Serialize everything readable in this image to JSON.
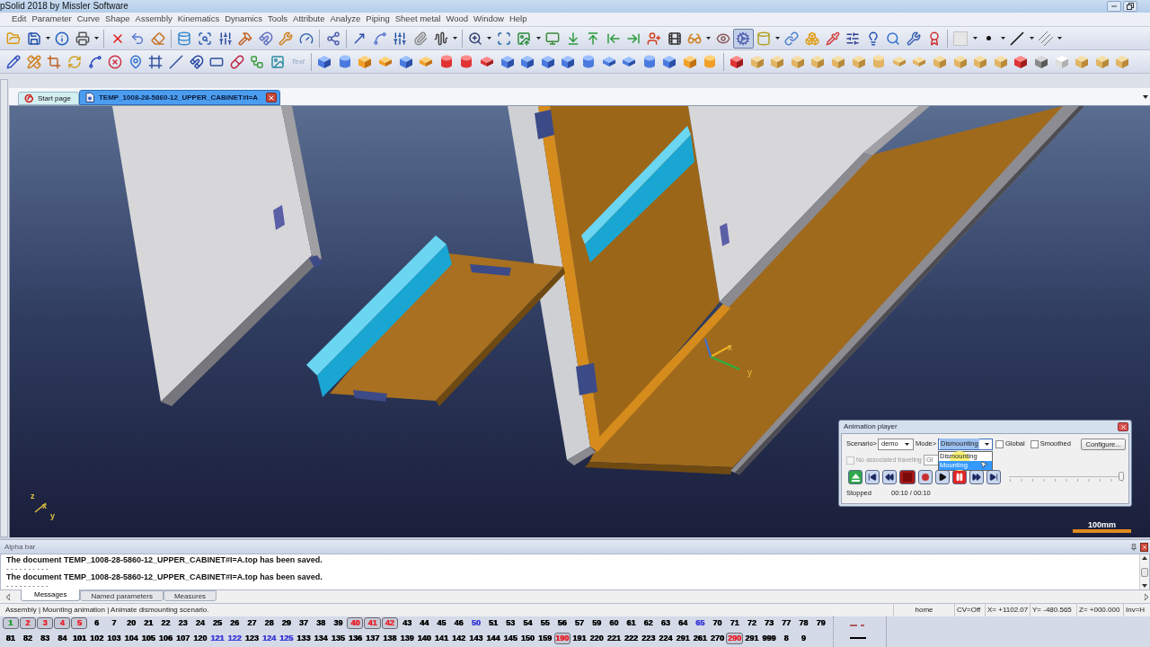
{
  "window": {
    "title": "pSolid 2018 by Missler Software"
  },
  "menu": [
    "Edit",
    "Parameter",
    "Curve",
    "Shape",
    "Assembly",
    "Kinematics",
    "Dynamics",
    "Tools",
    "Attribute",
    "Analyze",
    "Piping",
    "Sheet metal",
    "Wood",
    "Window",
    "Help"
  ],
  "toolbars": [
    {
      "buttons": [
        {
          "selected": false
        },
        {
          "selected": false
        },
        {
          "selected": false
        },
        {
          "selected": false
        },
        {
          "selected": false
        },
        {
          "selected": false
        },
        {
          "selected": false
        },
        {
          "selected": false
        },
        {
          "selected": false
        },
        {
          "selected": false
        },
        {
          "selected": false
        },
        {
          "selected": false
        },
        {
          "selected": false
        },
        {
          "selected": false
        },
        {
          "selected": false
        },
        {
          "selected": false
        },
        {
          "selected": false
        },
        {
          "selected": false
        },
        {
          "selected": false
        },
        {
          "selected": false
        },
        {
          "selected": false
        },
        {
          "selected": false
        },
        {
          "selected": false
        },
        {
          "selected": false
        },
        {
          "selected": false
        },
        {
          "selected": false
        },
        {
          "selected": false
        },
        {
          "selected": false
        },
        {
          "selected": false
        },
        {
          "selected": false
        },
        {
          "selected": false
        },
        {
          "selected": false
        },
        {
          "selected": true
        },
        {
          "selected": false
        },
        {
          "selected": false
        },
        {
          "selected": false
        },
        {
          "selected": false
        },
        {
          "selected": false
        },
        {
          "selected": false
        },
        {
          "selected": false
        },
        {
          "selected": false
        },
        {
          "selected": false
        },
        {
          "selected": false
        },
        {
          "selected": false
        },
        {
          "selected": false
        },
        {
          "selected": false
        }
      ]
    },
    {
      "buttons": [
        {
          "selected": false
        },
        {
          "selected": false
        },
        {
          "selected": false
        },
        {
          "selected": false
        },
        {
          "selected": false
        },
        {
          "selected": false
        },
        {
          "selected": false
        },
        {
          "selected": false
        },
        {
          "selected": false
        },
        {
          "selected": false
        },
        {
          "selected": false
        },
        {
          "selected": false
        },
        {
          "selected": false
        },
        {
          "selected": false
        },
        {
          "label": "Text",
          "selected": false
        },
        {
          "selected": false
        },
        {
          "selected": false
        },
        {
          "selected": false
        },
        {
          "selected": false
        },
        {
          "selected": false
        },
        {
          "selected": false
        },
        {
          "selected": false
        },
        {
          "selected": false
        },
        {
          "selected": false
        },
        {
          "selected": false
        },
        {
          "selected": false
        },
        {
          "selected": false
        },
        {
          "selected": false
        },
        {
          "selected": false
        },
        {
          "selected": false
        },
        {
          "selected": false
        },
        {
          "selected": false
        },
        {
          "selected": false
        },
        {
          "selected": false
        },
        {
          "selected": false
        },
        {
          "selected": false
        },
        {
          "selected": false
        },
        {
          "selected": false
        },
        {
          "selected": false
        },
        {
          "selected": false
        },
        {
          "selected": false
        },
        {
          "selected": false
        },
        {
          "selected": false
        },
        {
          "selected": false
        },
        {
          "selected": false
        },
        {
          "selected": false
        },
        {
          "selected": false
        },
        {
          "selected": false
        },
        {
          "selected": false
        },
        {
          "selected": false
        },
        {
          "selected": false
        },
        {
          "selected": false
        },
        {
          "selected": false
        },
        {
          "selected": false
        },
        {
          "selected": false
        }
      ]
    }
  ],
  "document_tabs": [
    {
      "kind": "start_page",
      "label": "Start page",
      "selected": false
    },
    {
      "kind": "document",
      "label": "TEMP_1008-28-5860-12_UPPER_CABINET#I=A",
      "selected": true
    }
  ],
  "viewport": {
    "triad_labels": [
      "x",
      "y"
    ],
    "corner_axis_labels": [
      "z",
      "x",
      "y"
    ],
    "scale_label": "100mm"
  },
  "animation_player": {
    "title": "Animation player",
    "scenario_label": "Scenario>",
    "scenario": "demo",
    "mode_label": "Mode>",
    "mode": "Dismounting",
    "mode_options": [
      {
        "label": "Dismounting",
        "selected": false
      },
      {
        "label": "Mounting",
        "selected": true
      }
    ],
    "global": {
      "label": "Global",
      "checked": false
    },
    "smoothed": {
      "label": "Smoothed",
      "checked": false
    },
    "configure": "Configure...",
    "traveling": {
      "label": "No associated traveling",
      "checked": false,
      "disabled": true
    },
    "traveling_field": "Gl",
    "progress": {
      "level": 1
    },
    "status": "Stopped",
    "time": "00:10 / 00:10"
  },
  "alpha_bar": {
    "title": "Alpha bar",
    "messages": [
      {
        "kind": "text",
        "text": "The document TEMP_1008-28-5860-12_UPPER_CABINET#I=A.top has been saved."
      },
      {
        "kind": "separator",
        "text": "- - - - - - - - - -"
      },
      {
        "kind": "text",
        "text": "The document TEMP_1008-28-5860-12_UPPER_CABINET#I=A.top has been saved."
      },
      {
        "kind": "separator",
        "text": "- - - - - - - - - -"
      }
    ],
    "tabs": [
      {
        "label": "Messages",
        "selected": true
      },
      {
        "label": "Named parameters",
        "selected": false
      },
      {
        "label": "Measures",
        "selected": false
      }
    ]
  },
  "status_bar": {
    "message": "Assembly | Mounting animation | Animate dismounting scenario.",
    "fields": [
      "home",
      "CV=Off",
      "X= +1102.07",
      "Y= -480.565",
      "Z= +000.000",
      "Inv=H"
    ]
  },
  "layers": {
    "rows": [
      [
        {
          "label": "1",
          "selected": true,
          "color": "#1e9e2e"
        },
        {
          "label": "2",
          "selected": true,
          "color": "#e8202a"
        },
        {
          "label": "3",
          "selected": true,
          "color": "#e8202a"
        },
        {
          "label": "4",
          "selected": true,
          "color": "#e8202a"
        },
        {
          "label": "5",
          "selected": true,
          "color": "#e8202a"
        },
        {
          "label": "6",
          "selected": false,
          "color": "#000000"
        },
        {
          "label": "7",
          "selected": false,
          "color": "#000000"
        },
        {
          "label": "20",
          "selected": false,
          "color": "#000000"
        },
        {
          "label": "21",
          "selected": false,
          "color": "#000000"
        },
        {
          "label": "22",
          "selected": false,
          "color": "#000000"
        },
        {
          "label": "23",
          "selected": false,
          "color": "#000000"
        },
        {
          "label": "24",
          "selected": false,
          "color": "#000000"
        },
        {
          "label": "25",
          "selected": false,
          "color": "#000000"
        },
        {
          "label": "26",
          "selected": false,
          "color": "#000000"
        },
        {
          "label": "27",
          "selected": false,
          "color": "#000000"
        },
        {
          "label": "28",
          "selected": false,
          "color": "#000000"
        },
        {
          "label": "29",
          "selected": false,
          "color": "#000000"
        },
        {
          "label": "37",
          "selected": false,
          "color": "#000000"
        },
        {
          "label": "38",
          "selected": false,
          "color": "#000000"
        },
        {
          "label": "39",
          "selected": false,
          "color": "#000000"
        },
        {
          "label": "40",
          "selected": true,
          "color": "#e8202a"
        },
        {
          "label": "41",
          "selected": true,
          "color": "#e8202a"
        },
        {
          "label": "42",
          "selected": true,
          "color": "#e8202a"
        },
        {
          "label": "43",
          "selected": false,
          "color": "#000000"
        },
        {
          "label": "44",
          "selected": false,
          "color": "#000000"
        },
        {
          "label": "45",
          "selected": false,
          "color": "#000000"
        },
        {
          "label": "46",
          "selected": false,
          "color": "#000000"
        },
        {
          "label": "50",
          "selected": false,
          "color": "#3c3cd8"
        },
        {
          "label": "51",
          "selected": false,
          "color": "#000000"
        },
        {
          "label": "53",
          "selected": false,
          "color": "#000000"
        },
        {
          "label": "54",
          "selected": false,
          "color": "#000000"
        },
        {
          "label": "55",
          "selected": false,
          "color": "#000000"
        },
        {
          "label": "56",
          "selected": false,
          "color": "#000000"
        },
        {
          "label": "57",
          "selected": false,
          "color": "#000000"
        },
        {
          "label": "59",
          "selected": false,
          "color": "#000000"
        },
        {
          "label": "60",
          "selected": false,
          "color": "#000000"
        },
        {
          "label": "61",
          "selected": false,
          "color": "#000000"
        },
        {
          "label": "62",
          "selected": false,
          "color": "#000000"
        },
        {
          "label": "63",
          "selected": false,
          "color": "#000000"
        },
        {
          "label": "64",
          "selected": false,
          "color": "#000000"
        },
        {
          "label": "65",
          "selected": false,
          "color": "#3c3cd8"
        },
        {
          "label": "70",
          "selected": false,
          "color": "#000000"
        },
        {
          "label": "71",
          "selected": false,
          "color": "#000000"
        },
        {
          "label": "72",
          "selected": false,
          "color": "#000000"
        },
        {
          "label": "73",
          "selected": false,
          "color": "#000000"
        },
        {
          "label": "77",
          "selected": false,
          "color": "#000000"
        },
        {
          "label": "78",
          "selected": false,
          "color": "#000000"
        },
        {
          "label": "79",
          "selected": false,
          "color": "#000000"
        }
      ],
      [
        {
          "label": "81",
          "selected": false,
          "color": "#000000"
        },
        {
          "label": "82",
          "selected": false,
          "color": "#000000"
        },
        {
          "label": "83",
          "selected": false,
          "color": "#000000"
        },
        {
          "label": "84",
          "selected": false,
          "color": "#000000"
        },
        {
          "label": "101",
          "selected": false,
          "color": "#000000"
        },
        {
          "label": "102",
          "selected": false,
          "color": "#000000"
        },
        {
          "label": "103",
          "selected": false,
          "color": "#000000"
        },
        {
          "label": "104",
          "selected": false,
          "color": "#000000"
        },
        {
          "label": "105",
          "selected": false,
          "color": "#000000"
        },
        {
          "label": "106",
          "selected": false,
          "color": "#000000"
        },
        {
          "label": "107",
          "selected": false,
          "color": "#000000"
        },
        {
          "label": "120",
          "selected": false,
          "color": "#000000"
        },
        {
          "label": "121",
          "selected": false,
          "color": "#3c3cd8"
        },
        {
          "label": "122",
          "selected": false,
          "color": "#3c3cd8"
        },
        {
          "label": "123",
          "selected": false,
          "color": "#000000"
        },
        {
          "label": "124",
          "selected": false,
          "color": "#3c3cd8"
        },
        {
          "label": "125",
          "selected": false,
          "color": "#3c3cd8"
        },
        {
          "label": "133",
          "selected": false,
          "color": "#000000"
        },
        {
          "label": "134",
          "selected": false,
          "color": "#000000"
        },
        {
          "label": "135",
          "selected": false,
          "color": "#000000"
        },
        {
          "label": "136",
          "selected": false,
          "color": "#000000"
        },
        {
          "label": "137",
          "selected": false,
          "color": "#000000"
        },
        {
          "label": "138",
          "selected": false,
          "color": "#000000"
        },
        {
          "label": "139",
          "selected": false,
          "color": "#000000"
        },
        {
          "label": "140",
          "selected": false,
          "color": "#000000"
        },
        {
          "label": "141",
          "selected": false,
          "color": "#000000"
        },
        {
          "label": "142",
          "selected": false,
          "color": "#000000"
        },
        {
          "label": "143",
          "selected": false,
          "color": "#000000"
        },
        {
          "label": "144",
          "selected": false,
          "color": "#000000"
        },
        {
          "label": "145",
          "selected": false,
          "color": "#000000"
        },
        {
          "label": "150",
          "selected": false,
          "color": "#000000"
        },
        {
          "label": "159",
          "selected": false,
          "color": "#000000"
        },
        {
          "label": "190",
          "selected": true,
          "color": "#e8202a"
        },
        {
          "label": "191",
          "selected": false,
          "color": "#000000"
        },
        {
          "label": "220",
          "selected": false,
          "color": "#000000"
        },
        {
          "label": "221",
          "selected": false,
          "color": "#000000"
        },
        {
          "label": "222",
          "selected": false,
          "color": "#000000"
        },
        {
          "label": "223",
          "selected": false,
          "color": "#000000"
        },
        {
          "label": "224",
          "selected": false,
          "color": "#000000"
        },
        {
          "label": "291",
          "selected": false,
          "color": "#000000"
        },
        {
          "label": "261",
          "selected": false,
          "color": "#000000"
        },
        {
          "label": "270",
          "selected": false,
          "color": "#000000"
        },
        {
          "label": "290",
          "selected": true,
          "color": "#e8202a"
        },
        {
          "label": "291",
          "selected": false,
          "color": "#000000"
        },
        {
          "label": "999",
          "selected": false,
          "color": "#000000"
        },
        {
          "label": "8",
          "selected": false,
          "color": "#000000"
        },
        {
          "label": "9",
          "selected": false,
          "color": "#000000"
        }
      ]
    ]
  }
}
